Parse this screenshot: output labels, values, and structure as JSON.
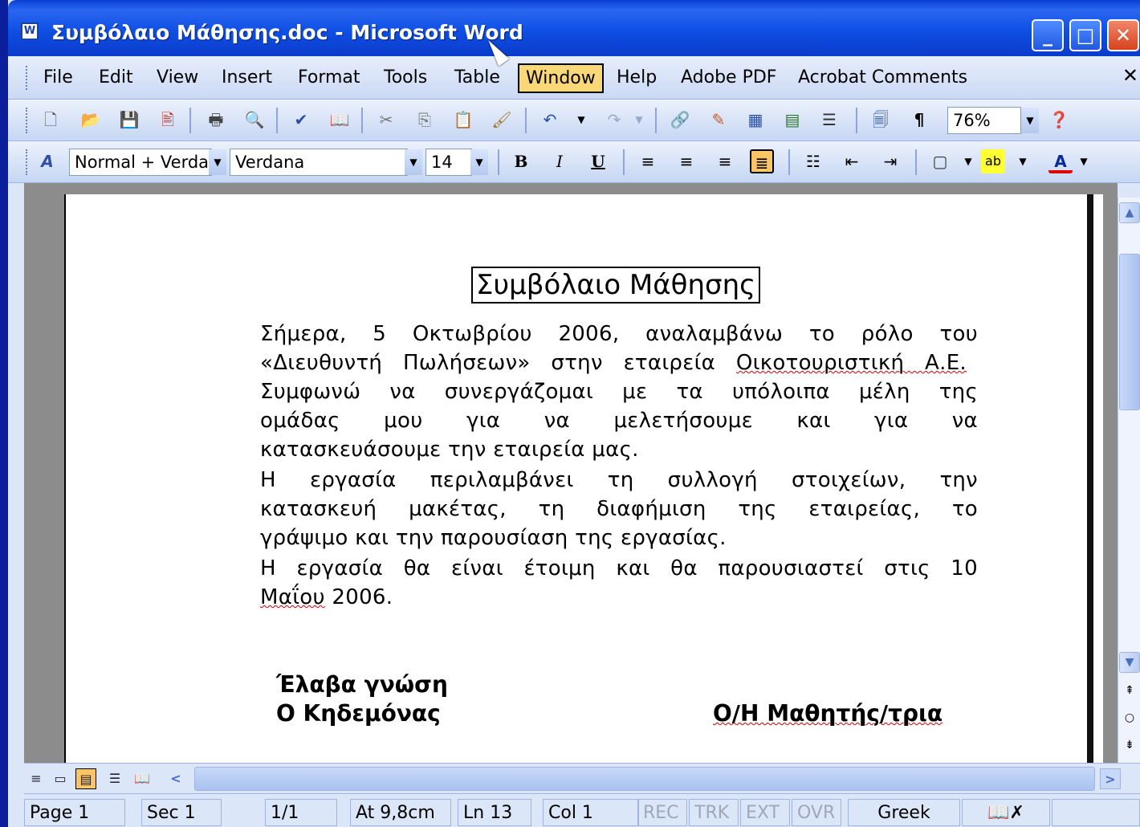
{
  "window": {
    "title": "Συμβόλαιο Μάθησης.doc - Microsoft Word",
    "app_icon": "word-doc-icon"
  },
  "menu": [
    "File",
    "Edit",
    "View",
    "Insert",
    "Format",
    "Tools",
    "Table",
    "Window",
    "Help",
    "Adobe PDF",
    "Acrobat Comments"
  ],
  "active_menu": "Window",
  "formatting": {
    "style": "Normal + Verda",
    "font": "Verdana",
    "size": "14",
    "zoom": "76%"
  },
  "document": {
    "title": "Συμβόλαιο Μάθησης",
    "lines": [
      "Σήμερα, 5 Οκτωβρίου 2006, αναλαμβάνω το ρόλο του",
      "Συμφωνώ να συνεργάζομαι με τα υπόλοιπα μέλη της",
      "ομάδας μου για να μελετήσουμε και για να",
      "κατασκευάσουμε την εταιρεία μας.",
      "Η εργασία περιλαμβάνει τη συλλογή στοιχείων, την",
      "κατασκευή μακέτας, τη διαφήμιση της εταιρείας, το",
      "γράψιμο και την παρουσίαση της εργασίας.",
      "Η εργασία θα είναι έτοιμη και θα παρουσιαστεί στις 10"
    ],
    "line2_start": "«Διευθυντή Πωλήσεων» στην εταιρεία ",
    "line2_company": "Οικοτουριστική Α.Ε.",
    "last_line_word": "Μαΐου",
    "last_line_rest": " 2006.",
    "sign_left_1": "Έλαβα γνώση",
    "sign_left_2": "Ο Κηδεμόνας",
    "sign_right": "Ο/Η Μαθητής/τρια"
  },
  "status": {
    "page": "Page 1",
    "sec": "Sec 1",
    "pages": "1/1",
    "at": "At 9,8cm",
    "ln": "Ln 13",
    "col": "Col 1",
    "rec": "REC",
    "trk": "TRK",
    "ext": "EXT",
    "ovr": "OVR",
    "lang": "Greek"
  }
}
